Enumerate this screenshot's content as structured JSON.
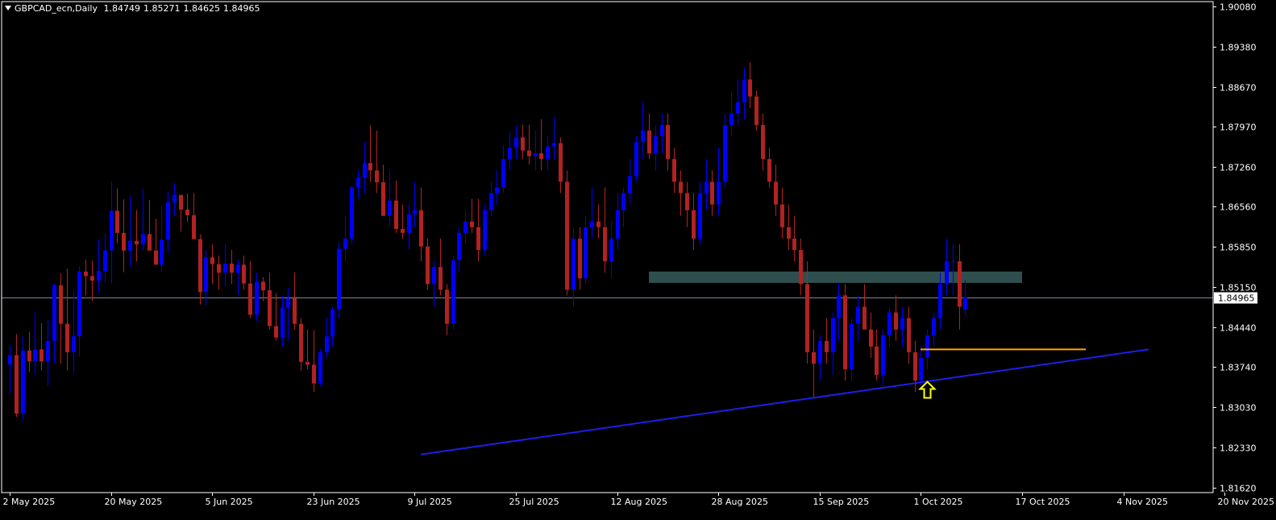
{
  "header": {
    "symbol": "GBPCAD_ecn,Daily",
    "open": "1.84749",
    "high": "1.85271",
    "low": "1.84625",
    "close": "1.84965"
  },
  "colors": {
    "background": "#000000",
    "bull_candle": "#0000ff",
    "bear_candle": "#b22222",
    "axis": "#ffffff",
    "bid_line": "#778899",
    "trendline": "#1e1ee6",
    "resistance_zone": "#2f4f4f",
    "support_line": "#ffa500",
    "arrow": "#ffff00"
  },
  "chart_data": {
    "type": "candlestick",
    "symbol": "GBPCAD_ecn",
    "timeframe": "Daily",
    "y_ticks": [
      "1.90080",
      "1.89380",
      "1.88670",
      "1.87970",
      "1.87260",
      "1.86560",
      "1.85850",
      "1.85150",
      "1.84440",
      "1.83740",
      "1.83030",
      "1.82330",
      "1.81620"
    ],
    "ylim": [
      1.8153,
      1.9017
    ],
    "x_labels": [
      "2 May 2025",
      "20 May 2025",
      "5 Jun 2025",
      "23 Jun 2025",
      "9 Jul 2025",
      "25 Jul 2025",
      "12 Aug 2025",
      "28 Aug 2025",
      "15 Sep 2025",
      "1 Oct 2025",
      "17 Oct 2025",
      "4 Nov 2025",
      "20 Nov 2025"
    ],
    "current_price": "1.84965",
    "candles": [
      [
        1.8378,
        1.8412,
        1.8328,
        1.8395
      ],
      [
        1.8395,
        1.8432,
        1.8286,
        1.8292
      ],
      [
        1.8292,
        1.8428,
        1.828,
        1.8403
      ],
      [
        1.8403,
        1.8436,
        1.8365,
        1.8384
      ],
      [
        1.8384,
        1.847,
        1.836,
        1.8405
      ],
      [
        1.8405,
        1.8451,
        1.8368,
        1.8384
      ],
      [
        1.8384,
        1.8457,
        1.8341,
        1.842
      ],
      [
        1.842,
        1.8521,
        1.838,
        1.8518
      ],
      [
        1.8518,
        1.8539,
        1.838,
        1.845
      ],
      [
        1.845,
        1.8547,
        1.8368,
        1.84
      ],
      [
        1.84,
        1.8509,
        1.8362,
        1.8428
      ],
      [
        1.8428,
        1.8551,
        1.8392,
        1.8542
      ],
      [
        1.8542,
        1.8563,
        1.85,
        1.8534
      ],
      [
        1.8534,
        1.8561,
        1.849,
        1.8526
      ],
      [
        1.8526,
        1.8599,
        1.8504,
        1.8543
      ],
      [
        1.8543,
        1.861,
        1.8522,
        1.8579
      ],
      [
        1.8579,
        1.87,
        1.852,
        1.8649
      ],
      [
        1.8649,
        1.8688,
        1.8592,
        1.861
      ],
      [
        1.861,
        1.8669,
        1.8541,
        1.8579
      ],
      [
        1.8579,
        1.8676,
        1.855,
        1.8596
      ],
      [
        1.8596,
        1.865,
        1.856,
        1.859
      ],
      [
        1.859,
        1.8688,
        1.8578,
        1.8608
      ],
      [
        1.8608,
        1.8668,
        1.8584,
        1.8579
      ],
      [
        1.8579,
        1.8635,
        1.8558,
        1.8554
      ],
      [
        1.8554,
        1.8657,
        1.8541,
        1.8598
      ],
      [
        1.8598,
        1.8683,
        1.8575,
        1.8664
      ],
      [
        1.8664,
        1.8698,
        1.864,
        1.8677
      ],
      [
        1.8677,
        1.8673,
        1.8612,
        1.8651
      ],
      [
        1.8651,
        1.8679,
        1.863,
        1.8641
      ],
      [
        1.8641,
        1.868,
        1.86,
        1.8599
      ],
      [
        1.8599,
        1.8607,
        1.8484,
        1.8506
      ],
      [
        1.8506,
        1.858,
        1.8482,
        1.8567
      ],
      [
        1.8567,
        1.859,
        1.852,
        1.8555
      ],
      [
        1.8555,
        1.857,
        1.851,
        1.854
      ],
      [
        1.854,
        1.859,
        1.8515,
        1.8556
      ],
      [
        1.8556,
        1.858,
        1.852,
        1.854
      ],
      [
        1.854,
        1.8563,
        1.85,
        1.8554
      ],
      [
        1.8554,
        1.857,
        1.851,
        1.8521
      ],
      [
        1.8521,
        1.856,
        1.846,
        1.8466
      ],
      [
        1.8466,
        1.854,
        1.8455,
        1.8524
      ],
      [
        1.8524,
        1.8532,
        1.849,
        1.8509
      ],
      [
        1.8509,
        1.854,
        1.844,
        1.8446
      ],
      [
        1.8446,
        1.8504,
        1.8421,
        1.8426
      ],
      [
        1.8426,
        1.85,
        1.841,
        1.8478
      ],
      [
        1.8478,
        1.8514,
        1.842,
        1.8495
      ],
      [
        1.8495,
        1.854,
        1.844,
        1.845
      ],
      [
        1.845,
        1.846,
        1.8368,
        1.8383
      ],
      [
        1.8383,
        1.844,
        1.837,
        1.8378
      ],
      [
        1.8378,
        1.8439,
        1.833,
        1.8345
      ],
      [
        1.8345,
        1.8405,
        1.834,
        1.84
      ],
      [
        1.84,
        1.846,
        1.839,
        1.8428
      ],
      [
        1.8428,
        1.848,
        1.841,
        1.8475
      ],
      [
        1.8475,
        1.8592,
        1.846,
        1.8582
      ],
      [
        1.8582,
        1.864,
        1.856,
        1.86
      ],
      [
        1.86,
        1.8693,
        1.859,
        1.869
      ],
      [
        1.869,
        1.872,
        1.867,
        1.8707
      ],
      [
        1.8707,
        1.877,
        1.868,
        1.8733
      ],
      [
        1.8733,
        1.88,
        1.87,
        1.872
      ],
      [
        1.872,
        1.879,
        1.868,
        1.8699
      ],
      [
        1.8699,
        1.873,
        1.864,
        1.864
      ],
      [
        1.864,
        1.872,
        1.862,
        1.8667
      ],
      [
        1.8667,
        1.8702,
        1.861,
        1.8617
      ],
      [
        1.8617,
        1.866,
        1.86,
        1.861
      ],
      [
        1.861,
        1.866,
        1.858,
        1.8643
      ],
      [
        1.8643,
        1.87,
        1.862,
        1.865
      ],
      [
        1.865,
        1.869,
        1.856,
        1.8586
      ],
      [
        1.8586,
        1.86,
        1.851,
        1.852
      ],
      [
        1.852,
        1.856,
        1.848,
        1.855
      ],
      [
        1.855,
        1.86,
        1.85,
        1.851
      ],
      [
        1.851,
        1.852,
        1.843,
        1.845
      ],
      [
        1.845,
        1.857,
        1.844,
        1.8562
      ],
      [
        1.8562,
        1.862,
        1.854,
        1.861
      ],
      [
        1.861,
        1.865,
        1.859,
        1.863
      ],
      [
        1.863,
        1.867,
        1.861,
        1.862
      ],
      [
        1.862,
        1.867,
        1.856,
        1.858
      ],
      [
        1.858,
        1.866,
        1.857,
        1.865
      ],
      [
        1.865,
        1.87,
        1.864,
        1.868
      ],
      [
        1.868,
        1.872,
        1.866,
        1.869
      ],
      [
        1.869,
        1.8765,
        1.868,
        1.874
      ],
      [
        1.874,
        1.8788,
        1.872,
        1.876
      ],
      [
        1.876,
        1.88,
        1.874,
        1.8778
      ],
      [
        1.8778,
        1.88,
        1.874,
        1.8755
      ],
      [
        1.8755,
        1.88,
        1.873,
        1.8745
      ],
      [
        1.8745,
        1.879,
        1.872,
        1.875
      ],
      [
        1.875,
        1.881,
        1.872,
        1.874
      ],
      [
        1.874,
        1.878,
        1.872,
        1.8762
      ],
      [
        1.8762,
        1.8815,
        1.874,
        1.8768
      ],
      [
        1.8768,
        1.8778,
        1.868,
        1.87
      ],
      [
        1.87,
        1.872,
        1.85,
        1.851
      ],
      [
        1.851,
        1.862,
        1.848,
        1.86
      ],
      [
        1.86,
        1.862,
        1.851,
        1.853
      ],
      [
        1.853,
        1.864,
        1.852,
        1.862
      ],
      [
        1.862,
        1.869,
        1.86,
        1.863
      ],
      [
        1.863,
        1.866,
        1.86,
        1.862
      ],
      [
        1.862,
        1.869,
        1.854,
        1.856
      ],
      [
        1.856,
        1.863,
        1.853,
        1.86
      ],
      [
        1.86,
        1.868,
        1.858,
        1.865
      ],
      [
        1.865,
        1.869,
        1.862,
        1.868
      ],
      [
        1.868,
        1.874,
        1.866,
        1.871
      ],
      [
        1.871,
        1.878,
        1.87,
        1.877
      ],
      [
        1.877,
        1.884,
        1.874,
        1.879
      ],
      [
        1.879,
        1.882,
        1.874,
        1.875
      ],
      [
        1.875,
        1.88,
        1.872,
        1.878
      ],
      [
        1.878,
        1.882,
        1.875,
        1.88
      ],
      [
        1.88,
        1.882,
        1.872,
        1.874
      ],
      [
        1.874,
        1.876,
        1.868,
        1.87
      ],
      [
        1.87,
        1.872,
        1.864,
        1.868
      ],
      [
        1.868,
        1.87,
        1.862,
        1.865
      ],
      [
        1.865,
        1.868,
        1.858,
        1.86
      ],
      [
        1.86,
        1.87,
        1.859,
        1.868
      ],
      [
        1.868,
        1.874,
        1.865,
        1.87
      ],
      [
        1.87,
        1.872,
        1.864,
        1.866
      ],
      [
        1.866,
        1.876,
        1.864,
        1.87
      ],
      [
        1.87,
        1.882,
        1.869,
        1.88
      ],
      [
        1.88,
        1.886,
        1.878,
        1.882
      ],
      [
        1.882,
        1.888,
        1.88,
        1.884
      ],
      [
        1.884,
        1.89,
        1.881,
        1.888
      ],
      [
        1.888,
        1.891,
        1.883,
        1.885
      ],
      [
        1.885,
        1.886,
        1.879,
        1.88
      ],
      [
        1.88,
        1.882,
        1.872,
        1.874
      ],
      [
        1.874,
        1.876,
        1.869,
        1.87
      ],
      [
        1.87,
        1.873,
        1.864,
        1.866
      ],
      [
        1.866,
        1.869,
        1.86,
        1.862
      ],
      [
        1.862,
        1.866,
        1.858,
        1.86
      ],
      [
        1.86,
        1.864,
        1.856,
        1.858
      ],
      [
        1.858,
        1.86,
        1.85,
        1.852
      ],
      [
        1.852,
        1.856,
        1.838,
        1.84
      ],
      [
        1.84,
        1.844,
        1.832,
        1.838
      ],
      [
        1.838,
        1.843,
        1.835,
        1.842
      ],
      [
        1.842,
        1.846,
        1.838,
        1.84
      ],
      [
        1.84,
        1.847,
        1.836,
        1.846
      ],
      [
        1.846,
        1.852,
        1.842,
        1.85
      ],
      [
        1.85,
        1.852,
        1.835,
        1.837
      ],
      [
        1.837,
        1.846,
        1.835,
        1.845
      ],
      [
        1.845,
        1.85,
        1.842,
        1.848
      ],
      [
        1.848,
        1.852,
        1.845,
        1.844
      ],
      [
        1.844,
        1.847,
        1.839,
        1.841
      ],
      [
        1.841,
        1.844,
        1.835,
        1.836
      ],
      [
        1.836,
        1.844,
        1.834,
        1.843
      ],
      [
        1.843,
        1.848,
        1.841,
        1.847
      ],
      [
        1.847,
        1.85,
        1.842,
        1.844
      ],
      [
        1.844,
        1.848,
        1.841,
        1.846
      ],
      [
        1.846,
        1.848,
        1.838,
        1.84
      ],
      [
        1.84,
        1.842,
        1.833,
        1.835
      ],
      [
        1.835,
        1.841,
        1.834,
        1.839
      ],
      [
        1.839,
        1.844,
        1.837,
        1.843
      ],
      [
        1.843,
        1.847,
        1.841,
        1.846
      ],
      [
        1.846,
        1.854,
        1.844,
        1.852
      ],
      [
        1.852,
        1.86,
        1.85,
        1.856
      ],
      [
        1.856,
        1.859,
        1.85,
        1.856
      ],
      [
        1.856,
        1.859,
        1.844,
        1.848
      ],
      [
        1.8475,
        1.8527,
        1.8463,
        1.8497
      ]
    ],
    "annotations": {
      "resistance_zone": {
        "y_top": 1.8542,
        "y_bottom": 1.8522
      },
      "support_line": {
        "y": 1.8405
      },
      "trendline": {
        "y_start": 1.822,
        "y_end": 1.8405
      }
    }
  }
}
